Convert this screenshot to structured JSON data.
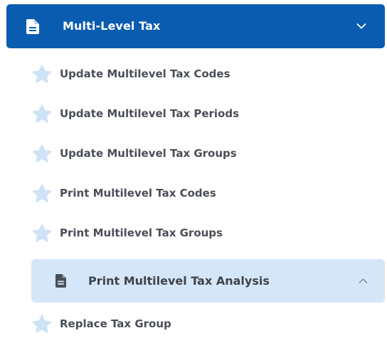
{
  "group": {
    "title": "Multi-Level Tax",
    "icon": "document-icon",
    "state_icon": "chevron-down-icon",
    "color": "#0a5cb0"
  },
  "items": [
    {
      "label": "Update Multilevel Tax Codes",
      "icon": "star-icon"
    },
    {
      "label": "Update Multilevel Tax Periods",
      "icon": "star-icon"
    },
    {
      "label": "Update Multilevel Tax Groups",
      "icon": "star-icon"
    },
    {
      "label": "Print Multilevel Tax Codes",
      "icon": "star-icon"
    },
    {
      "label": "Print Multilevel Tax Groups",
      "icon": "star-icon"
    }
  ],
  "subgroup": {
    "label": "Print Multilevel Tax Analysis",
    "icon": "document-icon",
    "state_icon": "chevron-up-icon",
    "color": "#d4e6f8"
  },
  "trailing_items": [
    {
      "label": "Replace Tax Group",
      "icon": "star-icon"
    }
  ],
  "colors": {
    "star": "#cfe3f7",
    "text": "#4a4e57"
  }
}
